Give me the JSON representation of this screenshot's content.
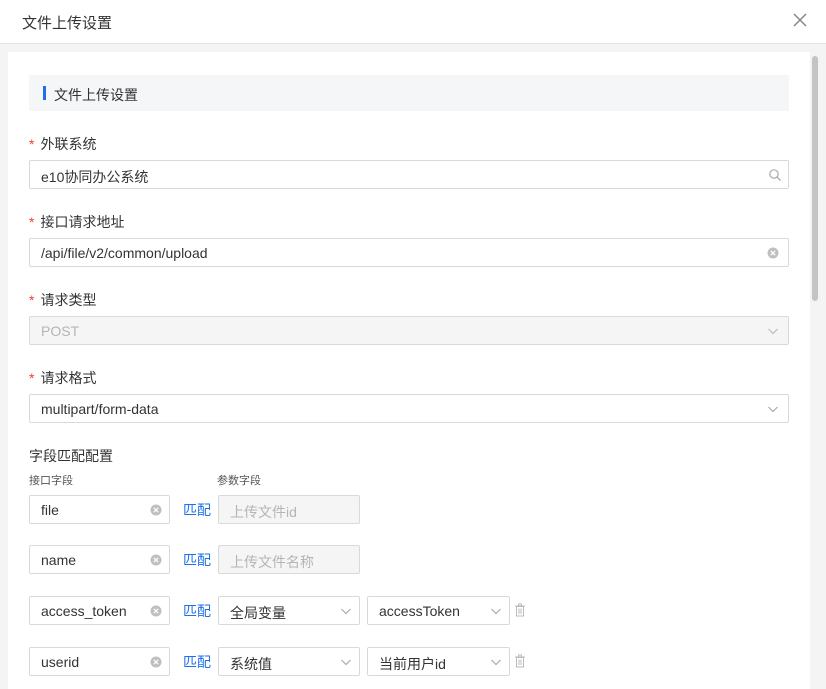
{
  "dialog": {
    "title": "文件上传设置"
  },
  "section": {
    "title": "文件上传设置"
  },
  "form": {
    "external_system": {
      "label": "外联系统",
      "value": "e10协同办公系统"
    },
    "request_url": {
      "label": "接口请求地址",
      "value": "/api/file/v2/common/upload"
    },
    "request_type": {
      "label": "请求类型",
      "value": "POST"
    },
    "request_format": {
      "label": "请求格式",
      "value": "multipart/form-data"
    }
  },
  "mapping": {
    "title": "字段匹配配置",
    "col_interface": "接口字段",
    "col_param": "参数字段",
    "match_label": "匹配",
    "rows": [
      {
        "field": "file",
        "param": "上传文件id"
      },
      {
        "field": "name",
        "param": "上传文件名称"
      },
      {
        "field": "access_token",
        "type": "全局变量",
        "value": "accessToken"
      },
      {
        "field": "userid",
        "type": "系统值",
        "value": "当前用户id"
      }
    ]
  }
}
